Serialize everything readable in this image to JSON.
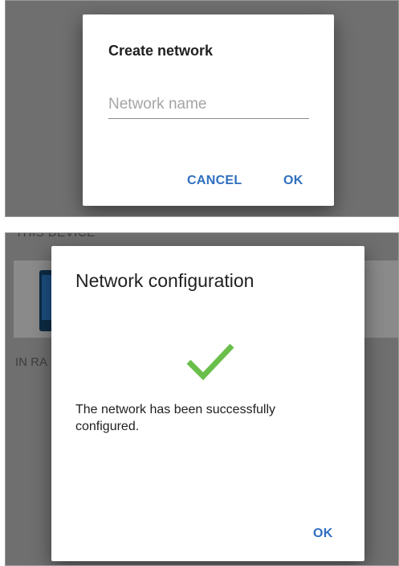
{
  "create_dialog": {
    "title": "Create network",
    "input_placeholder": "Network name",
    "input_value": "",
    "cancel_label": "CANCEL",
    "ok_label": "OK"
  },
  "background": {
    "this_device_label": "THIS DEVICE",
    "in_range_label": "IN RA"
  },
  "config_dialog": {
    "title": "Network configuration",
    "icon": "checkmark-icon",
    "message": "The network has been successfully configured.",
    "ok_label": "OK"
  },
  "colors": {
    "accent": "#2f6fbf",
    "success": "#6abf4b",
    "overlay": "#6f6f6f"
  }
}
